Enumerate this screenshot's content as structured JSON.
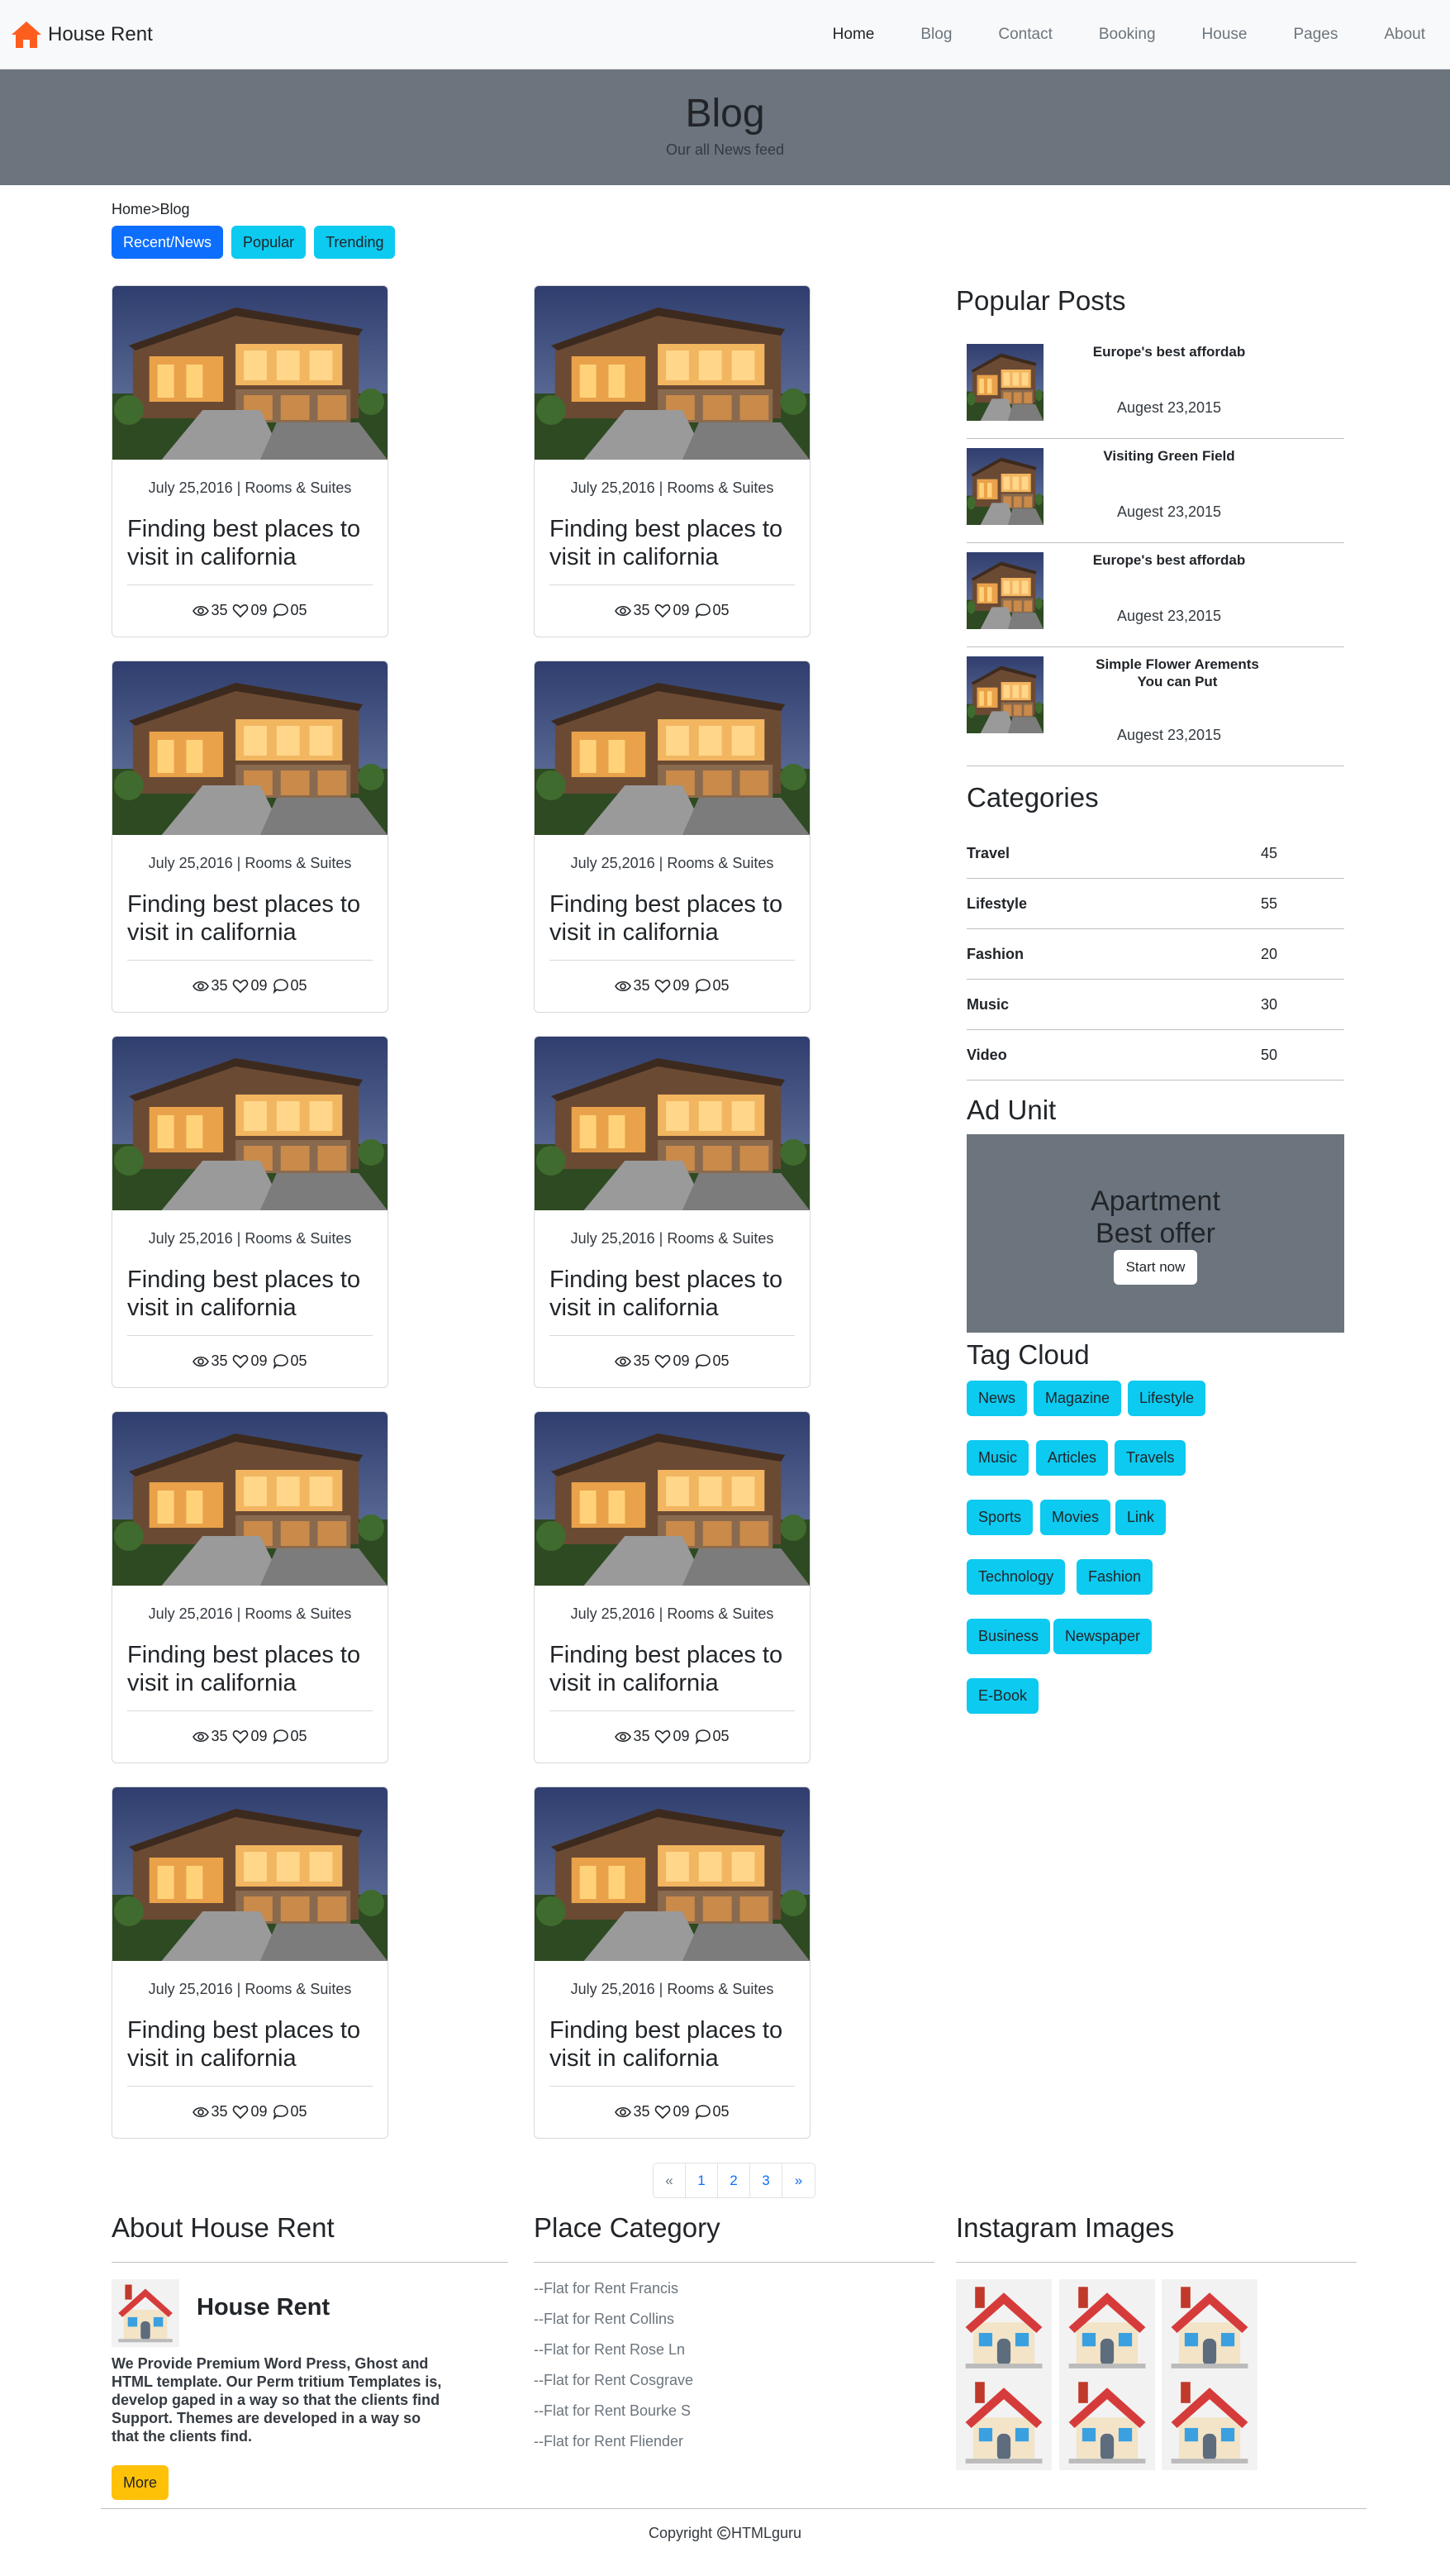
{
  "navbar": {
    "brand": "House Rent",
    "links": [
      "Home",
      "Blog",
      "Contact",
      "Booking",
      "House",
      "Pages",
      "About"
    ]
  },
  "hero": {
    "title": "Blog",
    "subtitle": "Our all News feed"
  },
  "breadcrumb": {
    "home": "Home",
    "sep": ">",
    "current": "Blog"
  },
  "filters": [
    "Recent/News",
    "Popular",
    "Trending"
  ],
  "card": {
    "meta": "July 25,2016 | Rooms & Suites",
    "title": "Finding best places to visit in california",
    "views": "35",
    "likes": "09",
    "comments": "05"
  },
  "pagination": [
    "«",
    "1",
    "2",
    "3",
    "»"
  ],
  "sidebar": {
    "popular_title": "Popular Posts",
    "popular_posts": [
      {
        "title": "Europe's best affordab",
        "date": "Augest 23,2015"
      },
      {
        "title": "Visiting Green Field",
        "date": "Augest 23,2015"
      },
      {
        "title": "Europe's best affordab",
        "date": "Augest 23,2015"
      },
      {
        "title": "Simple Flower Arements You can Put",
        "date": "Augest 23,2015"
      }
    ],
    "categories_title": "Categories",
    "categories": [
      {
        "name": "Travel",
        "count": "45"
      },
      {
        "name": "Lifestyle",
        "count": "55"
      },
      {
        "name": "Fashion",
        "count": "20"
      },
      {
        "name": "Music",
        "count": "30"
      },
      {
        "name": "Video",
        "count": "50"
      }
    ],
    "ad_title": "Ad Unit",
    "ad_line1": "Apartment",
    "ad_line2": "Best offer",
    "ad_button": "Start now",
    "tags_title": "Tag Cloud",
    "tags": [
      "News",
      "Magazine",
      "Lifestyle",
      "Music",
      "Articles",
      "Travels",
      "Sports",
      "Movies",
      "Link",
      "Technology",
      "Fashion",
      "Business",
      "Newspaper",
      "E-Book"
    ]
  },
  "footer": {
    "about_title": "About House Rent",
    "about_name": "House Rent",
    "about_text": "We Provide Premium Word Press, Ghost and HTML template. Our Perm tritium Templates is, develop gaped in a way so that the clients find Support. Themes are developed in a way so that the clients find.",
    "more": "More",
    "place_title": "Place Category",
    "places": [
      "--Flat for Rent Francis",
      "--Flat for Rent Collins",
      "--Flat for Rent Rose Ln",
      "--Flat for Rent Cosgrave",
      "--Flat for Rent Bourke S",
      "--Flat for Rent Fliender"
    ],
    "insta_title": "Instagram Images",
    "copyright": "Copyright",
    "copyright_brand": "HTMLguru"
  },
  "colors": {
    "primary": "#0d6efd",
    "info": "#0dcaf0",
    "warning": "#ffc107",
    "secondary": "#6c757d",
    "brand_orange": "#fd5e1e"
  }
}
